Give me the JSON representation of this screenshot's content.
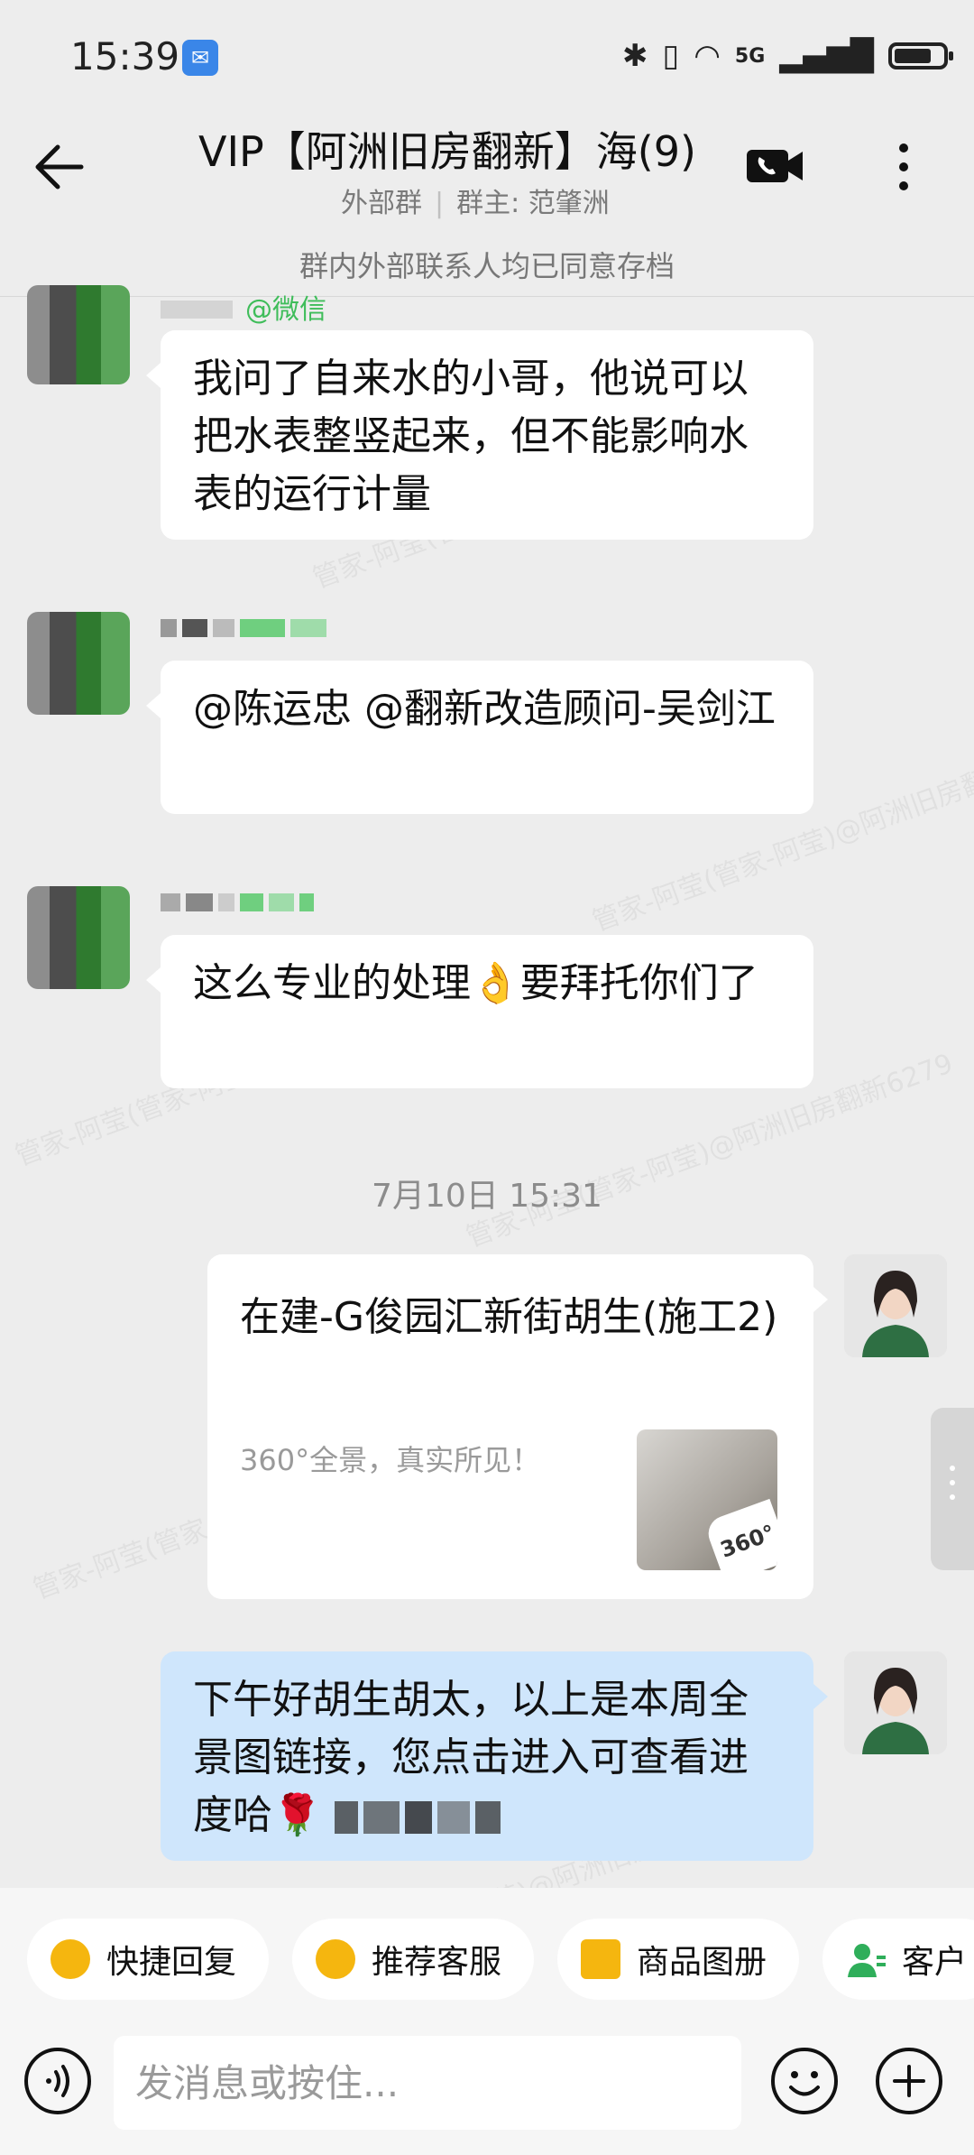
{
  "status_bar": {
    "time": "15:39",
    "network": "5G"
  },
  "header": {
    "title": "VIP【阿洲旧房翻新】海(9)",
    "group_type": "外部群",
    "group_owner": "群主: 范肇洲"
  },
  "archive_notice": "群内外部联系人均已同意存档",
  "messages": [
    {
      "sender_suffix": "@微信",
      "text": "我问了自来水的小哥，他说可以把水表整竖起来，但不能影响水表的运行计量"
    },
    {
      "text": "@陈运忠 @翻新改造顾问-吴剑江"
    },
    {
      "text": "这么专业的处理👌要拜托你们了"
    }
  ],
  "timestamp": "7月10日  15:31",
  "link_card": {
    "title": "在建-G俊园汇新街胡生(施工2)",
    "description": "360°全景，真实所见！",
    "badge": "360°"
  },
  "last_message": "下午好胡生胡太，以上是本周全景图链接，您点击进入可查看进度哈🌹",
  "watermark": "管家-阿莹(管家-阿莹)@阿洲旧房翻新6279",
  "quick_actions": [
    {
      "label": "快捷回复"
    },
    {
      "label": "推荐客服"
    },
    {
      "label": "商品图册"
    },
    {
      "label": "客户"
    }
  ],
  "input": {
    "placeholder": "发消息或按住..."
  }
}
